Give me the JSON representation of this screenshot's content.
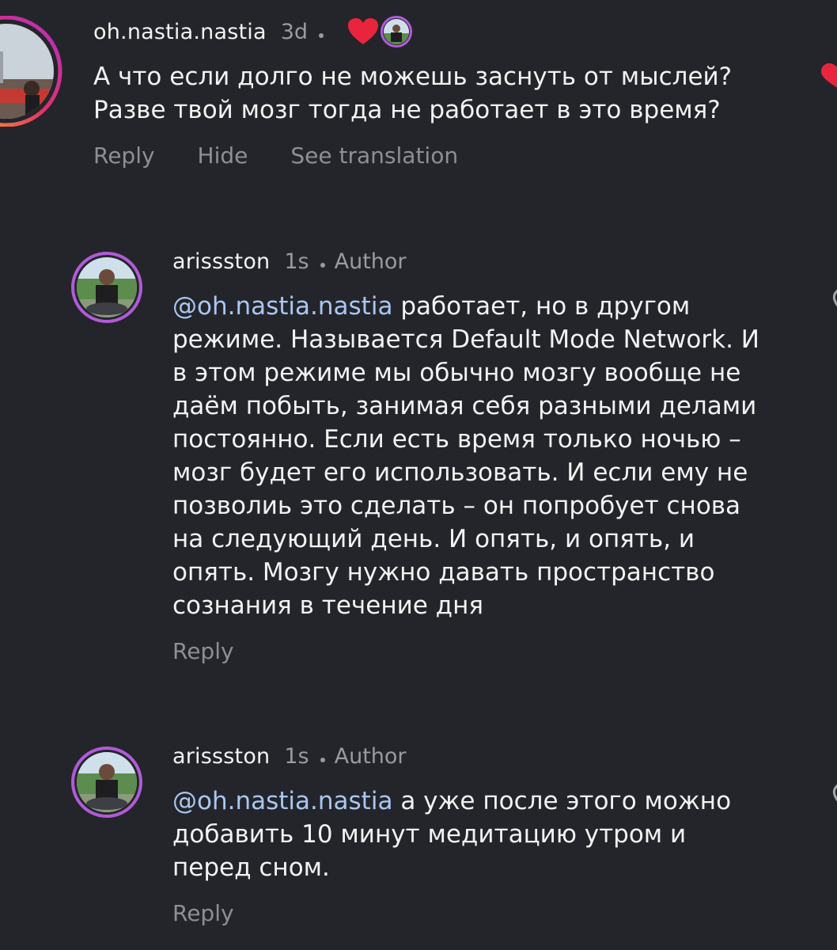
{
  "comments": [
    {
      "username": "oh.nastia.nastia",
      "time": "3d",
      "text": "А что если долго не можешь заснуть от мыслей? Разве твой мозг тогда не работает в это время?",
      "actions": {
        "reply": "Reply",
        "hide": "Hide",
        "translate": "See translation"
      },
      "liked_by_author": true
    },
    {
      "username": "arissston",
      "time": "1s",
      "badge": "Author",
      "mention": "@oh.nastia.nastia",
      "text": "работает, но в другом режиме. Называется Default Mode Network. И в этом режиме мы обычно мозгу вообще не даём побыть, занимая себя разными делами постоянно. Если есть время только ночью – мозг будет его использовать. И если ему не позволиь это сделать – он попробует снова на следующий день. И опять, и опять, и опять. Мозгу нужно давать пространство сознания в течение дня",
      "actions": {
        "reply": "Reply"
      }
    },
    {
      "username": "arissston",
      "time": "1s",
      "badge": "Author",
      "mention": "@oh.nastia.nastia",
      "text": "а уже после этого можно добавить 10 минут медитацию утром и перед сном.",
      "actions": {
        "reply": "Reply"
      }
    }
  ],
  "colors": {
    "background": "#24252a",
    "mention": "#a9c7f2",
    "heart": "#e8253d",
    "muted": "#9a9ba0"
  },
  "icons": [
    "avatar",
    "story-ring",
    "heart-icon",
    "author-like-avatar",
    "like-outline-icon"
  ]
}
